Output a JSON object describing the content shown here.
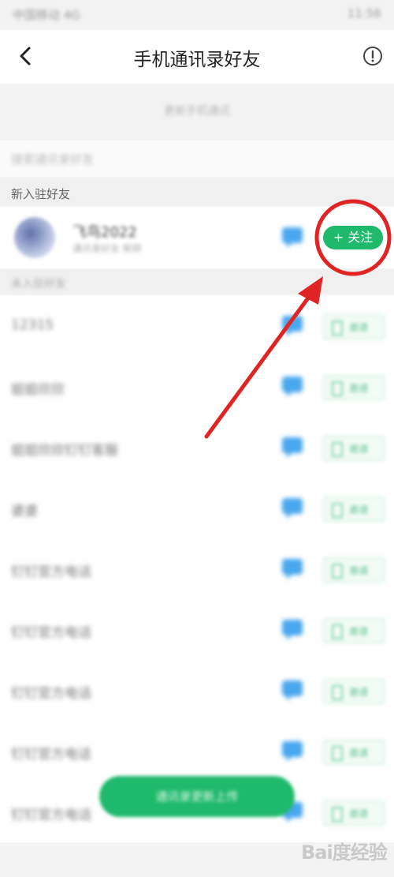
{
  "status_bar": {
    "left": "中国移动 4G",
    "right": "11:56"
  },
  "header": {
    "title": "手机通讯录好友"
  },
  "upload_bar": {
    "text": "更新手机通讯"
  },
  "search": {
    "placeholder": "搜索通讯录好友"
  },
  "sections": {
    "new_friends": "新入驻好友",
    "contacts": "未入驻好友"
  },
  "new_friend": {
    "name": "飞鸟2022",
    "subtitle": "通讯录好友 昵称",
    "follow_label": "+ 关注"
  },
  "contacts": [
    {
      "name": "12315",
      "invite_label": "邀请"
    },
    {
      "name": "姐姐欣欣",
      "invite_label": "邀请"
    },
    {
      "name": "姐姐欣欣钉钉客服",
      "invite_label": "邀请"
    },
    {
      "name": "婆婆",
      "invite_label": "邀请"
    },
    {
      "name": "钉钉官方电话",
      "invite_label": "邀请"
    },
    {
      "name": "钉钉官方电话",
      "invite_label": "邀请"
    },
    {
      "name": "钉钉官方电话",
      "invite_label": "邀请"
    },
    {
      "name": "钉钉官方电话",
      "invite_label": "邀请"
    },
    {
      "name": "钉钉官方电话",
      "invite_label": "邀请"
    }
  ],
  "upload_button": {
    "label": "通讯录更新上传"
  },
  "watermark": {
    "text": "Bai度经验"
  },
  "colors": {
    "accent": "#1fb96b",
    "annotation": "#e02424"
  }
}
